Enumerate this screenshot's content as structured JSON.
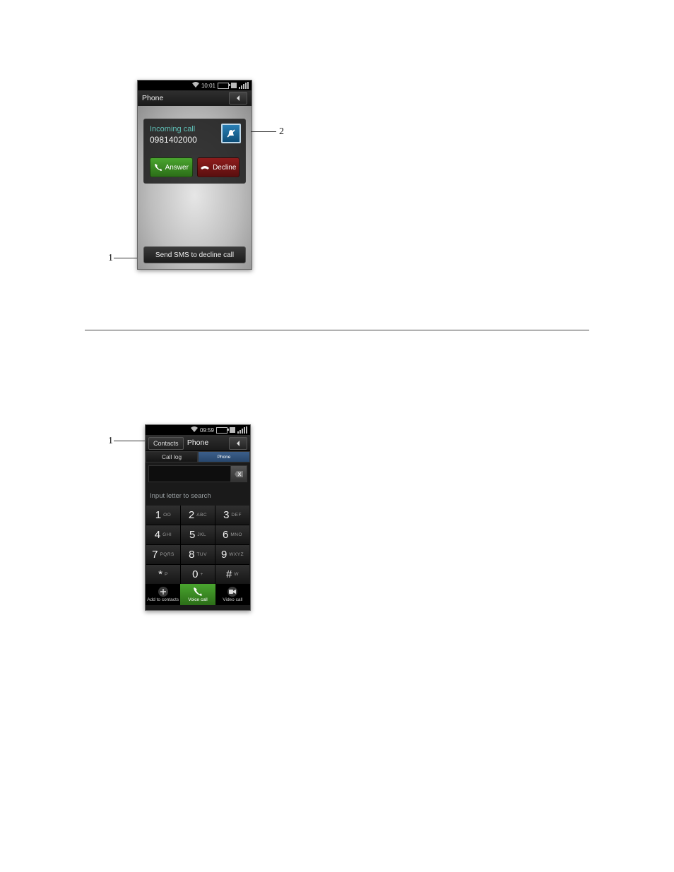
{
  "callouts": {
    "p1_left": "1",
    "p1_right": "2",
    "p2_left": "1"
  },
  "phone1": {
    "status_time": "10:01",
    "title": "Phone",
    "incoming_label": "Incoming call",
    "incoming_number": "0981402000",
    "answer_label": "Answer",
    "decline_label": "Decline",
    "sms_label": "Send SMS to decline call"
  },
  "phone2": {
    "status_time": "09:59",
    "contacts_label": "Contacts",
    "title": "Phone",
    "tab_call_log": "Call log",
    "tab_phone": "Phone",
    "search_hint": "Input letter to search",
    "keys": [
      {
        "digit": "1",
        "letters": "OO"
      },
      {
        "digit": "2",
        "letters": "ABC"
      },
      {
        "digit": "3",
        "letters": "DEF"
      },
      {
        "digit": "4",
        "letters": "GHI"
      },
      {
        "digit": "5",
        "letters": "JKL"
      },
      {
        "digit": "6",
        "letters": "MNO"
      },
      {
        "digit": "7",
        "letters": "PQRS"
      },
      {
        "digit": "8",
        "letters": "TUV"
      },
      {
        "digit": "9",
        "letters": "WXYZ"
      },
      {
        "digit": "*",
        "letters": "P"
      },
      {
        "digit": "0",
        "letters": "+"
      },
      {
        "digit": "#",
        "letters": "W"
      }
    ],
    "action_add": "Add to contacts",
    "action_voice": "Voice call",
    "action_video": "Video call"
  }
}
